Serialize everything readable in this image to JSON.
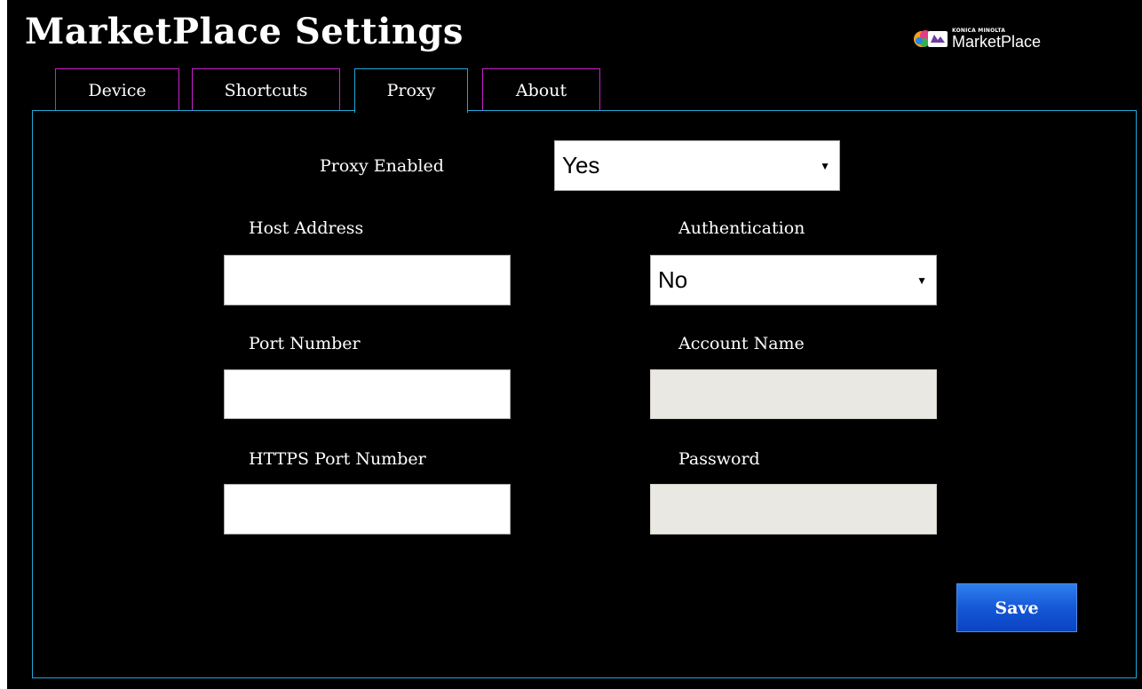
{
  "header": {
    "title": "MarketPlace Settings",
    "logo": {
      "brand": "KONICA MINOLTA",
      "name": "MarketPlace",
      "icon": "marketplace-logo-icon"
    }
  },
  "tabs": [
    {
      "label": "Device",
      "active": false
    },
    {
      "label": "Shortcuts",
      "active": false
    },
    {
      "label": "Proxy",
      "active": true
    },
    {
      "label": "About",
      "active": false
    }
  ],
  "proxy": {
    "proxy_enabled": {
      "label": "Proxy Enabled",
      "value": "Yes"
    },
    "host_address": {
      "label": "Host Address",
      "value": ""
    },
    "port_number": {
      "label": "Port Number",
      "value": ""
    },
    "https_port_number": {
      "label": "HTTPS Port Number",
      "value": ""
    },
    "authentication": {
      "label": "Authentication",
      "value": "No"
    },
    "account_name": {
      "label": "Account Name",
      "value": "",
      "disabled": true
    },
    "password": {
      "label": "Password",
      "value": "",
      "disabled": true
    },
    "save_label": "Save",
    "dropdown_icon": "caret-down-icon"
  },
  "colors": {
    "background": "#000000",
    "active_tab_border": "#21a7d6",
    "inactive_tab_border": "#cc1fcc",
    "panel_border": "#21a7d6",
    "save_button": "#1558d6",
    "disabled_input": "#e9e8e2"
  }
}
